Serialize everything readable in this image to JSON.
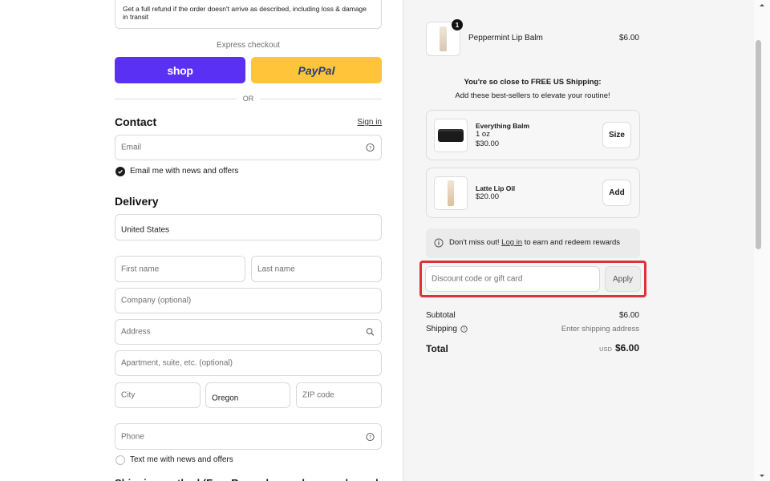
{
  "refund_notice": "Get a full refund if the order doesn't arrive as described, including loss & damage in transit",
  "express": {
    "label": "Express checkout",
    "shop_label": "shop",
    "paypal_label": "PayPal",
    "or_label": "OR"
  },
  "contact": {
    "title": "Contact",
    "sign_in": "Sign in",
    "email_placeholder": "Email",
    "email_opt_in": "Email me with news and offers"
  },
  "delivery": {
    "title": "Delivery",
    "country": "United States",
    "first_name_placeholder": "First name",
    "last_name_placeholder": "Last name",
    "company_placeholder": "Company (optional)",
    "address_placeholder": "Address",
    "apartment_placeholder": "Apartment, suite, etc. (optional)",
    "city_placeholder": "City",
    "state": "Oregon",
    "zip_placeholder": "ZIP code",
    "phone_placeholder": "Phone",
    "text_opt_in": "Text me with news and offers",
    "shipping_method_partial": "Shipping method (Free Rewards members, and members shipping)"
  },
  "cart": {
    "item_name": "Peppermint Lip Balm",
    "item_qty": "1",
    "item_price": "$6.00"
  },
  "upsell": {
    "title": "You're so close to FREE US Shipping:",
    "subtitle": "Add these best-sellers to elevate your routine!",
    "products": [
      {
        "name": "Everything Balm",
        "variant": "1 oz",
        "price": "$30.00",
        "button": "Size"
      },
      {
        "name": "Latte Lip Oil",
        "variant": "",
        "price": "$20.00",
        "button": "Add"
      }
    ]
  },
  "rewards": {
    "prefix": "Don't miss out! ",
    "link": "Log in",
    "suffix": " to earn and redeem rewards"
  },
  "discount": {
    "placeholder": "Discount code or gift card",
    "apply": "Apply"
  },
  "summary": {
    "subtotal_label": "Subtotal",
    "subtotal_value": "$6.00",
    "shipping_label": "Shipping",
    "shipping_value": "Enter shipping address",
    "total_label": "Total",
    "currency": "USD",
    "total_value": "$6.00"
  },
  "colors": {
    "shop_purple": "#5a31f4",
    "paypal_yellow": "#ffc439",
    "highlight_red": "#e0313a"
  }
}
